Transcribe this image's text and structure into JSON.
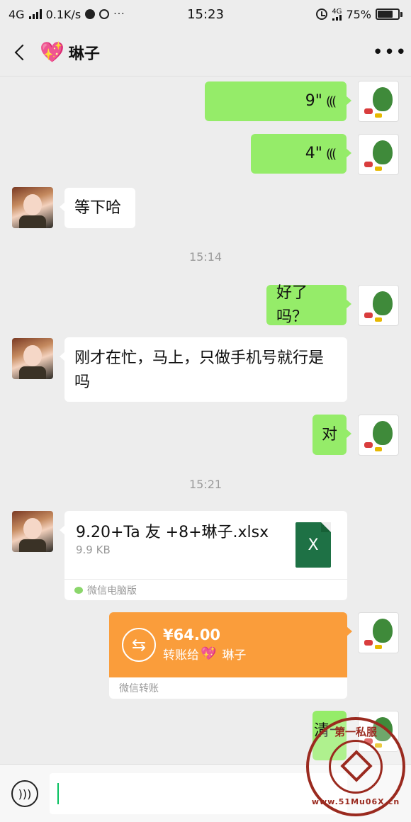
{
  "status_bar": {
    "network": "4G",
    "speed": "0.1K/s",
    "time": "15:23",
    "small_net": "4G",
    "battery": "75%",
    "battery_level": 0.75
  },
  "header": {
    "title": "琳子",
    "title_icon": "sparkling-heart-icon",
    "more": "•••"
  },
  "messages": {
    "voice1": {
      "duration": "9\"",
      "icon": "voice-wave-icon"
    },
    "voice2": {
      "duration": "4\"",
      "icon": "voice-wave-icon"
    },
    "msg1": "等下哈",
    "time1": "15:14",
    "msg2": "好了吗？",
    "msg3": "刚才在忙，马上，只做手机号就行是吗",
    "msg4": "对",
    "time2": "15:21",
    "file": {
      "name": "9.20+Ta 友 +8+琳子.xlsx",
      "size": "9.9 KB",
      "icon_letter": "X",
      "source": "微信电脑版"
    },
    "transfer": {
      "amount": "¥64.00",
      "to_prefix": "转账给",
      "to_name": "琳子",
      "label": "微信转账"
    },
    "msg5": "清一"
  },
  "input": {
    "placeholder": ""
  },
  "watermark": {
    "top": "第一私服",
    "bottom": "www.51Mu06X.cn"
  },
  "colors": {
    "sent_bubble": "#95ec69",
    "transfer_orange": "#fa9d3b",
    "excel_green": "#1e7145"
  }
}
